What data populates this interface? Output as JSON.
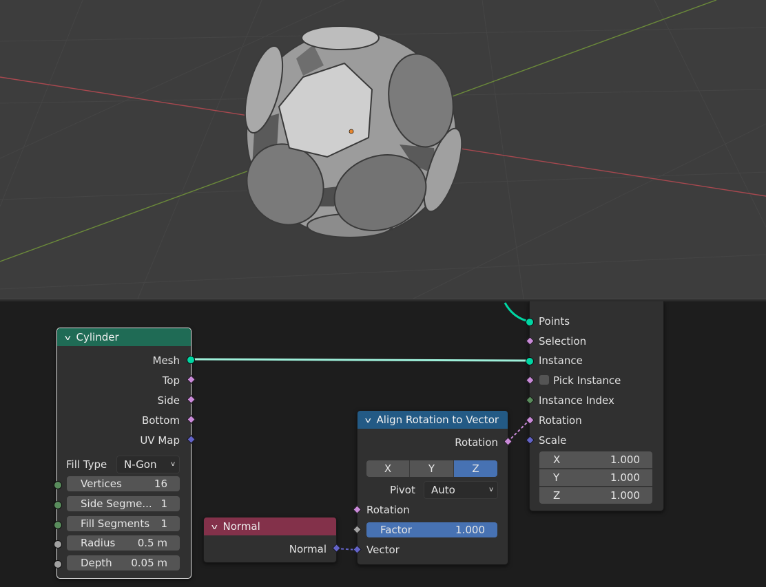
{
  "nodes": {
    "cylinder": {
      "title": "Cylinder",
      "outputs": [
        "Mesh",
        "Top",
        "Side",
        "Bottom",
        "UV Map"
      ],
      "fill_type_label": "Fill Type",
      "fill_type_value": "N-Gon",
      "inputs": [
        {
          "label": "Vertices",
          "value": "16"
        },
        {
          "label": "Side Segme...",
          "value": "1"
        },
        {
          "label": "Fill Segments",
          "value": "1"
        },
        {
          "label": "Radius",
          "value": "0.5 m"
        },
        {
          "label": "Depth",
          "value": "0.05 m"
        }
      ]
    },
    "instance_on_points": {
      "sockets": [
        "Points",
        "Selection",
        "Instance",
        "Pick Instance",
        "Instance Index",
        "Rotation",
        "Scale"
      ],
      "scale": [
        {
          "axis": "X",
          "value": "1.000"
        },
        {
          "axis": "Y",
          "value": "1.000"
        },
        {
          "axis": "Z",
          "value": "1.000"
        }
      ]
    },
    "align": {
      "title": "Align Rotation to Vector",
      "output": "Rotation",
      "axes": [
        "X",
        "Y",
        "Z"
      ],
      "active_axis": "Z",
      "pivot_label": "Pivot",
      "pivot_value": "Auto",
      "input_rotation": "Rotation",
      "factor_label": "Factor",
      "factor_value": "1.000",
      "input_vector": "Vector"
    },
    "normal": {
      "title": "Normal",
      "output": "Normal"
    }
  },
  "colors": {
    "geometry_socket": "#00d6a3",
    "rotation_socket": "#c98ad8",
    "vector_socket": "#6363c7",
    "int_socket": "#598c5c",
    "float_socket": "#a1a1a1",
    "geometry_header": "#1f6b55",
    "vector_header": "#235a85",
    "input_header": "#83314a",
    "accent_blue": "#4772b3"
  }
}
